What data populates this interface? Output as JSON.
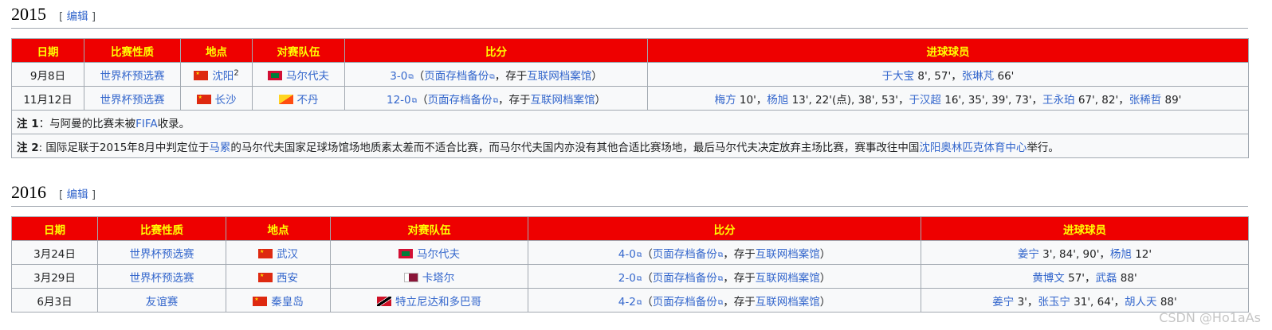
{
  "sections": [
    {
      "year": "2015",
      "edit_open": "[",
      "edit_label": "编辑",
      "edit_close": "]",
      "headers": [
        "日期",
        "比赛性质",
        "地点",
        "对赛队伍",
        "比分",
        "进球球员"
      ],
      "rows": [
        {
          "date": "9月8日",
          "type": "世界杯预选赛",
          "venue": "沈阳",
          "venue_sup": "2",
          "venue_flag": "china-flag",
          "opponent": "马尔代夫",
          "opponent_flag": "maldives-flag",
          "score": "3-0",
          "archive_open": "（",
          "archive_link": "页面存档备份",
          "archive_mid": "，存于",
          "archive_site": "互联网档案馆",
          "archive_close": "）",
          "scorers": [
            {
              "name": "于大宝",
              "mins": " 8', 57'",
              "sep": "，"
            },
            {
              "name": "张琳芃",
              "mins": " 66'",
              "sep": ""
            }
          ]
        },
        {
          "date": "11月12日",
          "type": "世界杯预选赛",
          "venue": "长沙",
          "venue_sup": "",
          "venue_flag": "china-flag",
          "opponent": "不丹",
          "opponent_flag": "bhutan-flag",
          "score": "12-0",
          "archive_open": "（",
          "archive_link": "页面存档备份",
          "archive_mid": "，存于",
          "archive_site": "互联网档案馆",
          "archive_close": "）",
          "scorers": [
            {
              "name": "梅方",
              "mins": " 10'",
              "sep": "，"
            },
            {
              "name": "杨旭",
              "mins": " 13', 22'(点), 38', 53'",
              "sep": "，"
            },
            {
              "name": "于汉超",
              "mins": " 16', 35', 39', 73'",
              "sep": "，"
            },
            {
              "name": "王永珀",
              "mins": " 67', 82'",
              "sep": "，"
            },
            {
              "name": "张稀哲",
              "mins": " 89'",
              "sep": ""
            }
          ]
        }
      ],
      "notes": [
        {
          "label": "注 1",
          "parts": [
            {
              "t": "：与阿曼的比赛未被",
              "link": false
            },
            {
              "t": "FIFA",
              "link": true
            },
            {
              "t": "收录。",
              "link": false
            }
          ]
        },
        {
          "label": "注 2",
          "parts": [
            {
              "t": ": 国际足联于2015年8月中判定位于",
              "link": false
            },
            {
              "t": "马累",
              "link": true
            },
            {
              "t": "的马尔代夫国家足球场馆场地质素太差而不适合比赛，而马尔代夫国内亦没有其他合适比赛场地，最后马尔代夫决定放弃主场比赛，赛事改往中国",
              "link": false
            },
            {
              "t": "沈阳奥林匹克体育中心",
              "link": true
            },
            {
              "t": "举行。",
              "link": false
            }
          ]
        }
      ]
    },
    {
      "year": "2016",
      "edit_open": "[",
      "edit_label": "编辑",
      "edit_close": "]",
      "headers": [
        "日期",
        "比赛性质",
        "地点",
        "对赛队伍",
        "比分",
        "进球球员"
      ],
      "rows": [
        {
          "date": "3月24日",
          "type": "世界杯预选赛",
          "venue": "武汉",
          "venue_sup": "",
          "venue_flag": "china-flag",
          "opponent": "马尔代夫",
          "opponent_flag": "maldives-flag",
          "score": "4-0",
          "archive_open": "（",
          "archive_link": "页面存档备份",
          "archive_mid": "，存于",
          "archive_site": "互联网档案馆",
          "archive_close": "）",
          "scorers": [
            {
              "name": "姜宁",
              "mins": " 3', 84', 90'",
              "sep": "，"
            },
            {
              "name": "杨旭",
              "mins": " 12'",
              "sep": ""
            }
          ]
        },
        {
          "date": "3月29日",
          "type": "世界杯预选赛",
          "venue": "西安",
          "venue_sup": "",
          "venue_flag": "china-flag",
          "opponent": "卡塔尔",
          "opponent_flag": "qatar-flag",
          "score": "2-0",
          "archive_open": "（",
          "archive_link": "页面存档备份",
          "archive_mid": "，存于",
          "archive_site": "互联网档案馆",
          "archive_close": "）",
          "scorers": [
            {
              "name": "黄博文",
              "mins": " 57'",
              "sep": "，"
            },
            {
              "name": "武磊",
              "mins": " 88'",
              "sep": ""
            }
          ]
        },
        {
          "date": "6月3日",
          "type": "友谊赛",
          "venue": "秦皇岛",
          "venue_sup": "",
          "venue_flag": "china-flag",
          "opponent": "特立尼达和多巴哥",
          "opponent_flag": "trinidad-flag",
          "score": "4-2",
          "archive_open": "（",
          "archive_link": "页面存档备份",
          "archive_mid": "，存于",
          "archive_site": "互联网档案馆",
          "archive_close": "）",
          "scorers": [
            {
              "name": "姜宁",
              "mins": " 3'",
              "sep": "，"
            },
            {
              "name": "张玉宁",
              "mins": " 31', 64'",
              "sep": "，"
            },
            {
              "name": "胡人天",
              "mins": " 88'",
              "sep": ""
            }
          ]
        }
      ],
      "notes": []
    }
  ],
  "watermark": "CSDN @Ho1aAs",
  "colors": {
    "header_bg": "#ee0000",
    "header_text": "#ffff00",
    "link": "#3366cc",
    "cell_bg": "#f8f9fa"
  }
}
